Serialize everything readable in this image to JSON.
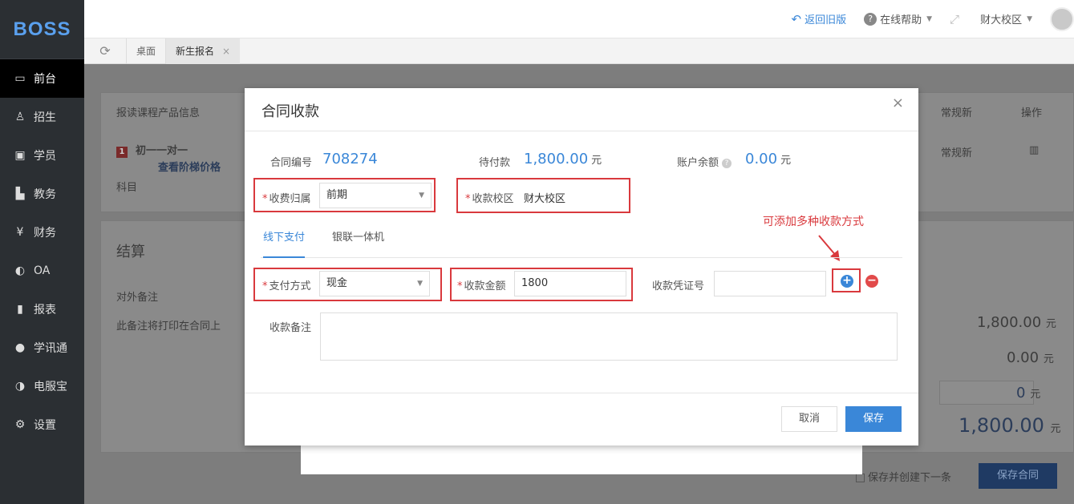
{
  "app": {
    "logo": "BOSS"
  },
  "sidebar": {
    "items": [
      {
        "label": "前台",
        "icon": "calendar-icon",
        "glyph": "▭"
      },
      {
        "label": "招生",
        "icon": "user-add-icon",
        "glyph": "♙"
      },
      {
        "label": "学员",
        "icon": "id-card-icon",
        "glyph": "▣"
      },
      {
        "label": "教务",
        "icon": "book-icon",
        "glyph": "▙"
      },
      {
        "label": "财务",
        "icon": "yen-icon",
        "glyph": "¥"
      },
      {
        "label": "OA",
        "icon": "toggle-icon",
        "glyph": "◐"
      },
      {
        "label": "报表",
        "icon": "bar-chart-icon",
        "glyph": "▮"
      },
      {
        "label": "学讯通",
        "icon": "location-icon",
        "glyph": "●"
      },
      {
        "label": "电服宝",
        "icon": "phone-icon",
        "glyph": "◑"
      },
      {
        "label": "设置",
        "icon": "gear-icon",
        "glyph": "⚙"
      }
    ]
  },
  "header": {
    "back_old": "返回旧版",
    "help": "在线帮助",
    "campus": "财大校区"
  },
  "tabs": [
    {
      "label": "桌面"
    },
    {
      "label": "新生报名",
      "close": "×"
    }
  ],
  "background": {
    "product_info": "报读课程产品信息",
    "course_name": "初一一对一",
    "view_price": "查看阶梯价格",
    "subject": "科目",
    "status1": "常规新",
    "status2": "常规新",
    "operation": "操作",
    "settle": "结算",
    "remark_label": "对外备注",
    "remark_hint": "此备注将打印在合同上",
    "sum1": "1,800.00",
    "sum2": "0.00",
    "sum3": "0",
    "sum4": "1,800.00",
    "unit": "元",
    "save_and_new": "保存并创建下一条",
    "save_contract": "保存合同"
  },
  "modal": {
    "title": "合同收款",
    "close": "×",
    "contract_no_label": "合同编号",
    "contract_no": "708274",
    "due_label": "待付款",
    "due_value": "1,800.00",
    "balance_label": "账户余额",
    "balance_value": "0.00",
    "unit": "元",
    "fee_belong_label": "收费归属",
    "fee_belong_value": "前期",
    "campus_label": "收款校区",
    "campus_value": "财大校区",
    "tab_offline": "线下支付",
    "tab_unionpay": "银联一体机",
    "annotation": "可添加多种收款方式",
    "pay_method_label": "支付方式",
    "pay_method_value": "现金",
    "amount_label": "收款金额",
    "amount_value": "1800",
    "voucher_label": "收款凭证号",
    "voucher_value": "",
    "remark_label": "收款备注",
    "remark_value": "",
    "cancel": "取消",
    "save": "保存"
  }
}
